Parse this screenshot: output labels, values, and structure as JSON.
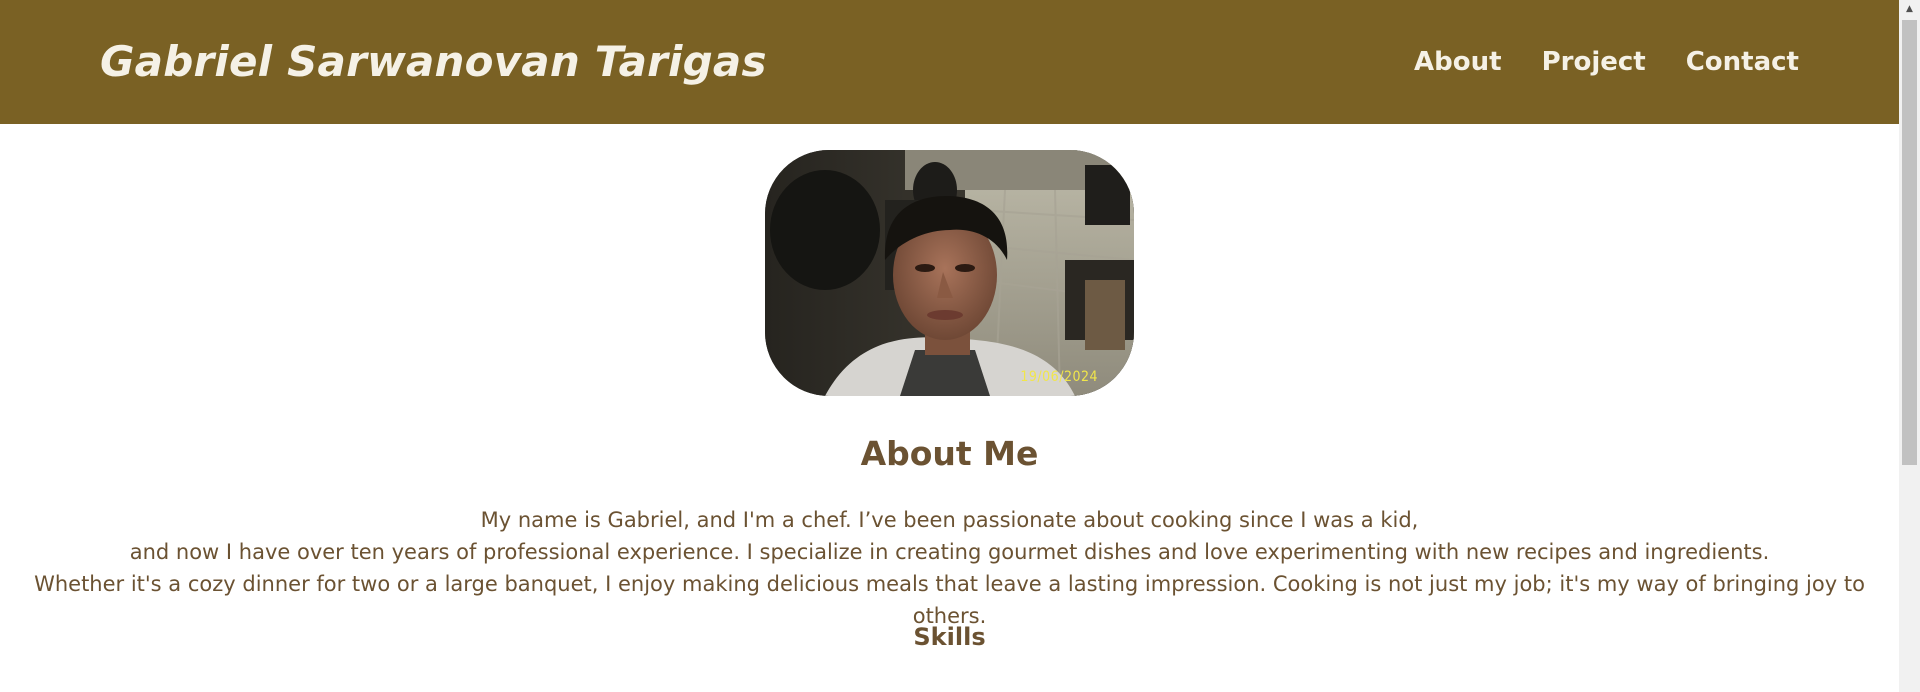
{
  "header": {
    "brand": "Gabriel Sarwanovan Tarigas",
    "nav": [
      {
        "label": "About"
      },
      {
        "label": "Project"
      },
      {
        "label": "Contact"
      }
    ]
  },
  "profile_photo": {
    "date_stamp": "19/06/2024"
  },
  "about": {
    "title": "About Me",
    "lines": [
      "My name is Gabriel, and I'm a chef. I’ve been passionate about cooking since I was a kid,",
      "and now I have over ten years of professional experience. I specialize in creating gourmet dishes and love experimenting with new recipes and ingredients.",
      "Whether it's a cozy dinner for two or a large banquet, I enjoy making delicious meals that leave a lasting impression. Cooking is not just my job; it's my way of bringing joy to others."
    ]
  },
  "skills": {
    "title": "Skills"
  },
  "colors": {
    "header_bg": "#7a6124",
    "header_text": "#f5f1e6",
    "body_text": "#6b5232",
    "date_stamp": "#f1e64a"
  },
  "icons": {
    "scroll_up": "triangle-up-icon"
  }
}
